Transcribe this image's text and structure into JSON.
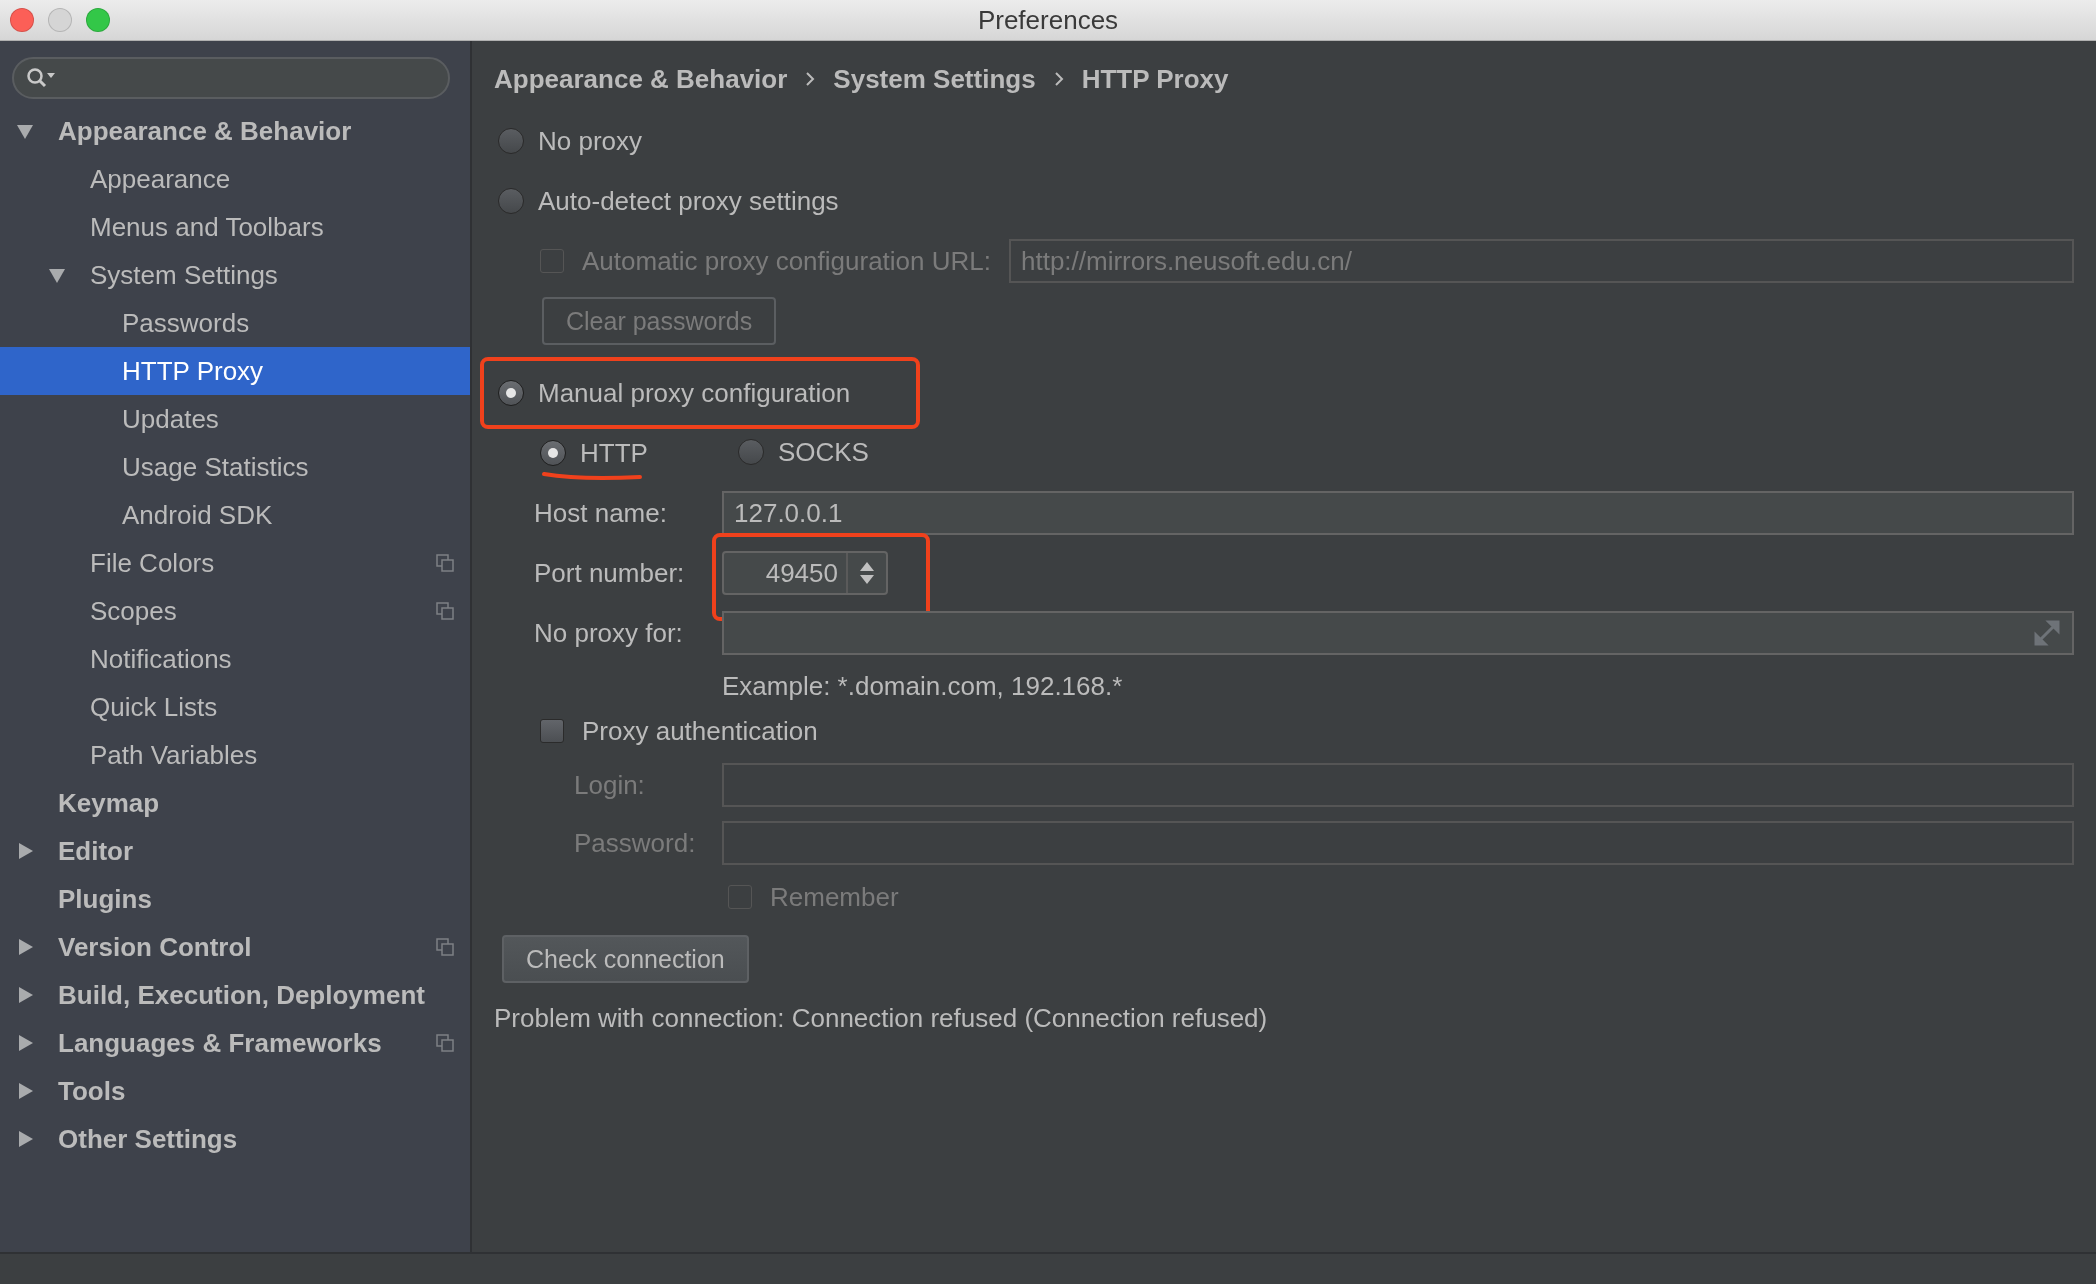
{
  "window": {
    "title": "Preferences"
  },
  "sidebar": {
    "items": [
      {
        "kind": "folder",
        "label": "Appearance & Behavior",
        "bold": true,
        "expanded": true,
        "selected": false,
        "project_level": false,
        "children": [
          {
            "kind": "page",
            "label": "Appearance",
            "selected": false,
            "project_level": false
          },
          {
            "kind": "page",
            "label": "Menus and Toolbars",
            "selected": false,
            "project_level": false
          },
          {
            "kind": "folder",
            "label": "System Settings",
            "bold": false,
            "expanded": true,
            "selected": false,
            "project_level": false,
            "children": [
              {
                "kind": "page",
                "label": "Passwords",
                "selected": false,
                "project_level": false
              },
              {
                "kind": "page",
                "label": "HTTP Proxy",
                "selected": true,
                "project_level": false
              },
              {
                "kind": "page",
                "label": "Updates",
                "selected": false,
                "project_level": false
              },
              {
                "kind": "page",
                "label": "Usage Statistics",
                "selected": false,
                "project_level": false
              },
              {
                "kind": "page",
                "label": "Android SDK",
                "selected": false,
                "project_level": false
              }
            ]
          },
          {
            "kind": "page",
            "label": "File Colors",
            "selected": false,
            "project_level": true
          },
          {
            "kind": "page",
            "label": "Scopes",
            "selected": false,
            "project_level": true
          },
          {
            "kind": "page",
            "label": "Notifications",
            "selected": false,
            "project_level": false
          },
          {
            "kind": "page",
            "label": "Quick Lists",
            "selected": false,
            "project_level": false
          },
          {
            "kind": "page",
            "label": "Path Variables",
            "selected": false,
            "project_level": false
          }
        ]
      },
      {
        "kind": "page",
        "label": "Keymap",
        "bold": true,
        "selected": false,
        "project_level": false
      },
      {
        "kind": "folder",
        "label": "Editor",
        "bold": true,
        "expanded": false,
        "selected": false,
        "project_level": false
      },
      {
        "kind": "page",
        "label": "Plugins",
        "bold": true,
        "selected": false,
        "project_level": false
      },
      {
        "kind": "folder",
        "label": "Version Control",
        "bold": true,
        "expanded": false,
        "selected": false,
        "project_level": true
      },
      {
        "kind": "folder",
        "label": "Build, Execution, Deployment",
        "bold": true,
        "expanded": false,
        "selected": false,
        "project_level": false
      },
      {
        "kind": "folder",
        "label": "Languages & Frameworks",
        "bold": true,
        "expanded": false,
        "selected": false,
        "project_level": true
      },
      {
        "kind": "folder",
        "label": "Tools",
        "bold": true,
        "expanded": false,
        "selected": false,
        "project_level": false
      },
      {
        "kind": "folder",
        "label": "Other Settings",
        "bold": true,
        "expanded": false,
        "selected": false,
        "project_level": false
      }
    ]
  },
  "breadcrumb": [
    "Appearance & Behavior",
    "System Settings",
    "HTTP Proxy"
  ],
  "proxy_modes": [
    {
      "label": "No proxy",
      "selected": false
    },
    {
      "label": "Auto-detect proxy settings",
      "selected": false
    },
    {
      "label": "Manual proxy configuration",
      "selected": true,
      "highlighted": true
    }
  ],
  "auto_config": {
    "label": "Automatic proxy configuration URL:",
    "checked": false,
    "disabled": true,
    "value": "http://mirrors.neusoft.edu.cn/"
  },
  "clear_passwords": {
    "label": "Clear passwords",
    "disabled": true
  },
  "manual": {
    "protocols": [
      {
        "label": "HTTP",
        "selected": true,
        "underlined": true
      },
      {
        "label": "SOCKS",
        "selected": false,
        "underlined": false
      }
    ],
    "fields": [
      {
        "kind": "text",
        "label": "Host name:",
        "value": "127.0.0.1"
      },
      {
        "kind": "spinner",
        "label": "Port number:",
        "value": "49450",
        "highlighted": true
      },
      {
        "kind": "expandable",
        "label": "No proxy for:"
      }
    ],
    "example": "Example: *.domain.com, 192.168.*",
    "auth": {
      "label": "Proxy authentication",
      "checked": false,
      "fields": [
        {
          "label": "Login:",
          "disabled": true
        },
        {
          "label": "Password:",
          "disabled": true
        }
      ],
      "remember": {
        "label": "Remember",
        "checked": false,
        "disabled": true
      }
    }
  },
  "check_button": {
    "label": "Check connection"
  },
  "status": "Problem with connection: Connection refused (Connection refused)"
}
